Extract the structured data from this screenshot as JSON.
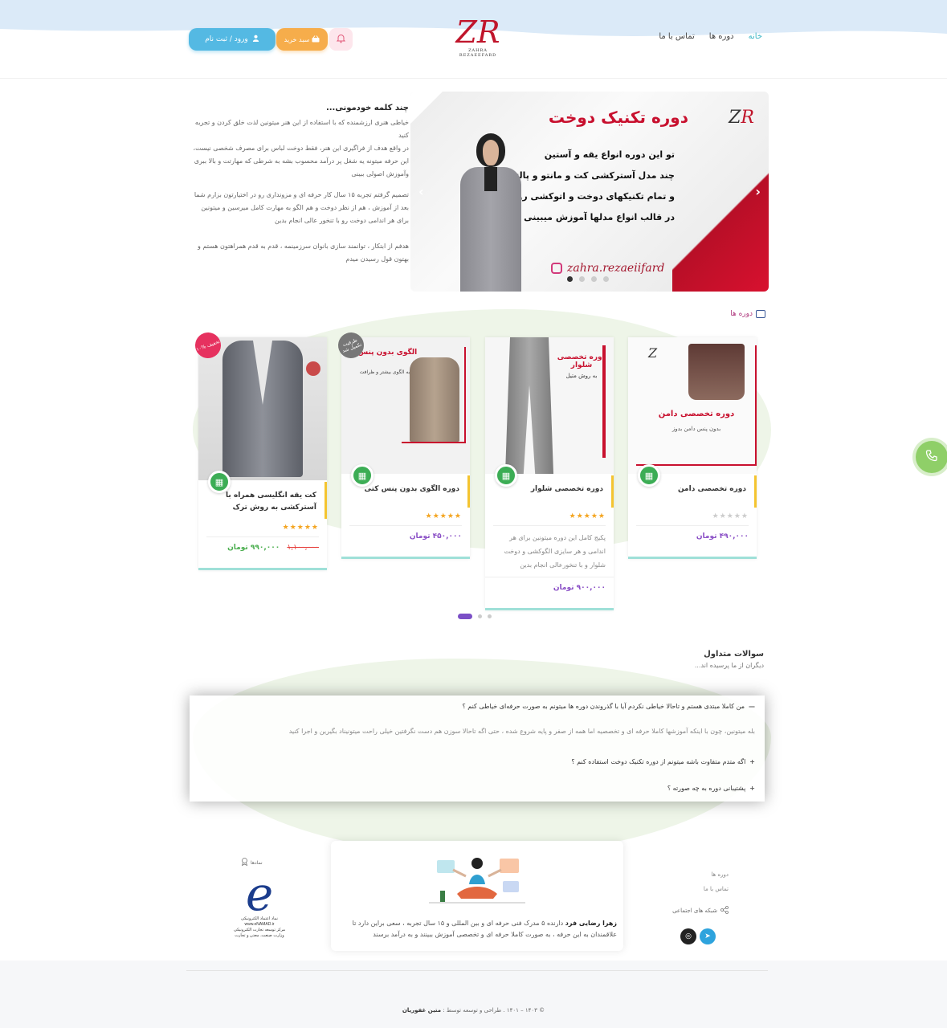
{
  "nav": {
    "home": "خانه",
    "courses": "دوره ها",
    "contact": "تماس با ما"
  },
  "logo": {
    "mark": "Z",
    "mark_accent": "R",
    "caption": "ZAHRA REZAEEFARD"
  },
  "header_buttons": {
    "login": "ورود / ثبت نام",
    "cart": "سبد خرید"
  },
  "intro": {
    "title": "چند کلمه خودمونی...",
    "paragraphs": [
      "خیاطی هنری ارزشمنده که با استفاده از این هنر میتونین لذت خلق کردن و تجربه کنید",
      "در واقع هدف از فراگیری این هنر، فقط دوخت لباس برای مصرف شخصی نیست،",
      "این حرفه میتونه یه شغل پر درآمد محسوب بشه به شرطی که مهارتت و بالا ببری وآموزش اصولی ببینی",
      "تصمیم گرفتم تجربه ۱۵ سال کار حرفه ای و مزونداری رو در اختیارتون بزارم شما بعد از آموزش ، هم از نظر دوخت و هم الگو به مهارت کامل میرسین و میتونین برای هر اندامی دوخت رو با تنخور عالی انجام بدین",
      "هدفم از ابتکار ، توانمند سازی بانوان سرزمینمه ، قدم به قدم همراهتون هستم و بهتون قول رسیدن میدم"
    ]
  },
  "banner": {
    "title": "دوره تکنیک دوخت",
    "lines": [
      "تو این دوره انواع یقه و آستین",
      "چند مدل آسترکشی کت و مانتو و پالتو",
      "و تمام تکنیکهای دوخت و اتوکشی رو",
      "در قالب انواع مدلها آموزش میبینی"
    ],
    "instagram": "zahra.rezaeiifard",
    "slides": 4,
    "active_slide": 1
  },
  "courses_label": "دوره ها",
  "cards": [
    {
      "title": "دوره تخصصی دامن",
      "price": "۴۹۰,۰۰۰ تومان",
      "rating": 0,
      "desc": "",
      "image_caption": "دوره تخصصی دامن",
      "image_sub": "بدون پنس دامن بدوز"
    },
    {
      "title": "دوره تخصصی شلوار",
      "price": "۹۰۰,۰۰۰ تومان",
      "rating": 5,
      "desc": "پکیج کامل این دوره میتونین برای هر اندامی و هر سایزی الگوکشی و دوخت شلوار و با تنخورعالی انجام بدین",
      "image_caption": "دوره تخصصی شلوار",
      "image_sub": "به روش متیل"
    },
    {
      "title": "دوره الگوی بدون پنس کتی",
      "price": "۴۵۰,۰۰۰ تومان",
      "rating": 5,
      "desc": "",
      "image_caption": "الگوی بدون پنس",
      "image_sub": "به الگوی بیشتر و ظرافت",
      "badge": "ظرفیت تکمیل شد"
    },
    {
      "title": "کت یقه انگلیسی همراه با آسترکشی به روش ترک",
      "price": "۹۹۰,۰۰۰ تومان",
      "old_price": "۱,۱۰۰,۰۰۰",
      "rating": 5,
      "desc": "",
      "badge": "۱۰% تخفیف"
    }
  ],
  "faq": {
    "title": "سوالات متداول",
    "subtitle": "دیگران از ما پرسیده اند...",
    "items": [
      {
        "q": "من کاملا مبتدی هستم و تاحالا خیاطی نکردم آیا با گذروندن دوره ها میتونم به صورت حرفه‌ای خیاطی کنم ؟",
        "a": "بله میتونین، چون با اینکه آموزشها کاملا حرفه ای و تخصصیه اما همه از صفر و پایه شروع شده ، حتی اگه تاحالا سوزن هم دست نگرفتین خیلی راحت میتونیناد بگیرین و اجرا کنید",
        "open": true
      },
      {
        "q": "اگه متدم متفاوت باشه میتونم از دوره تکنیک دوخت استفاده کنم ؟",
        "open": false
      },
      {
        "q": "پشتیبانی دوره به چه صورته ؟",
        "open": false
      }
    ]
  },
  "footer": {
    "about_name": "زهرا رضایی فرد",
    "about_text": " دارنده ۵ مدرک فنی حرفه ای و بین المللی و ۱۵ سال تجربه ، سعی براین دارد تا علاقمندان به این حرفه ، به صورت کاملا حرفه ای و تخصصی آموزش ببینند و به درآمد برسند",
    "links": [
      "دوره ها",
      "تماس با ما"
    ],
    "social_label": "شبکه های اجتماعی",
    "symbols_label": "نمادها",
    "enamad_lines": [
      "نماد اعتماد الکترونیکی",
      "www.eNAMAD.ir",
      "مرکز توسعه تجارت الکترونیکی",
      "وزارت صنعت، معدن و تجارت"
    ],
    "copyright_prefix": "© ۱۴۰۳ – ۱۴۰۱ . طراحی و توسعه توسط : ",
    "copyright_author": "متین غفوریان"
  },
  "colors": {
    "accent": "#3ab5c5",
    "login": "#54b9e3",
    "cart": "#f6ad4b",
    "price": "#8a4fc6",
    "brand_red": "#c8102e"
  }
}
